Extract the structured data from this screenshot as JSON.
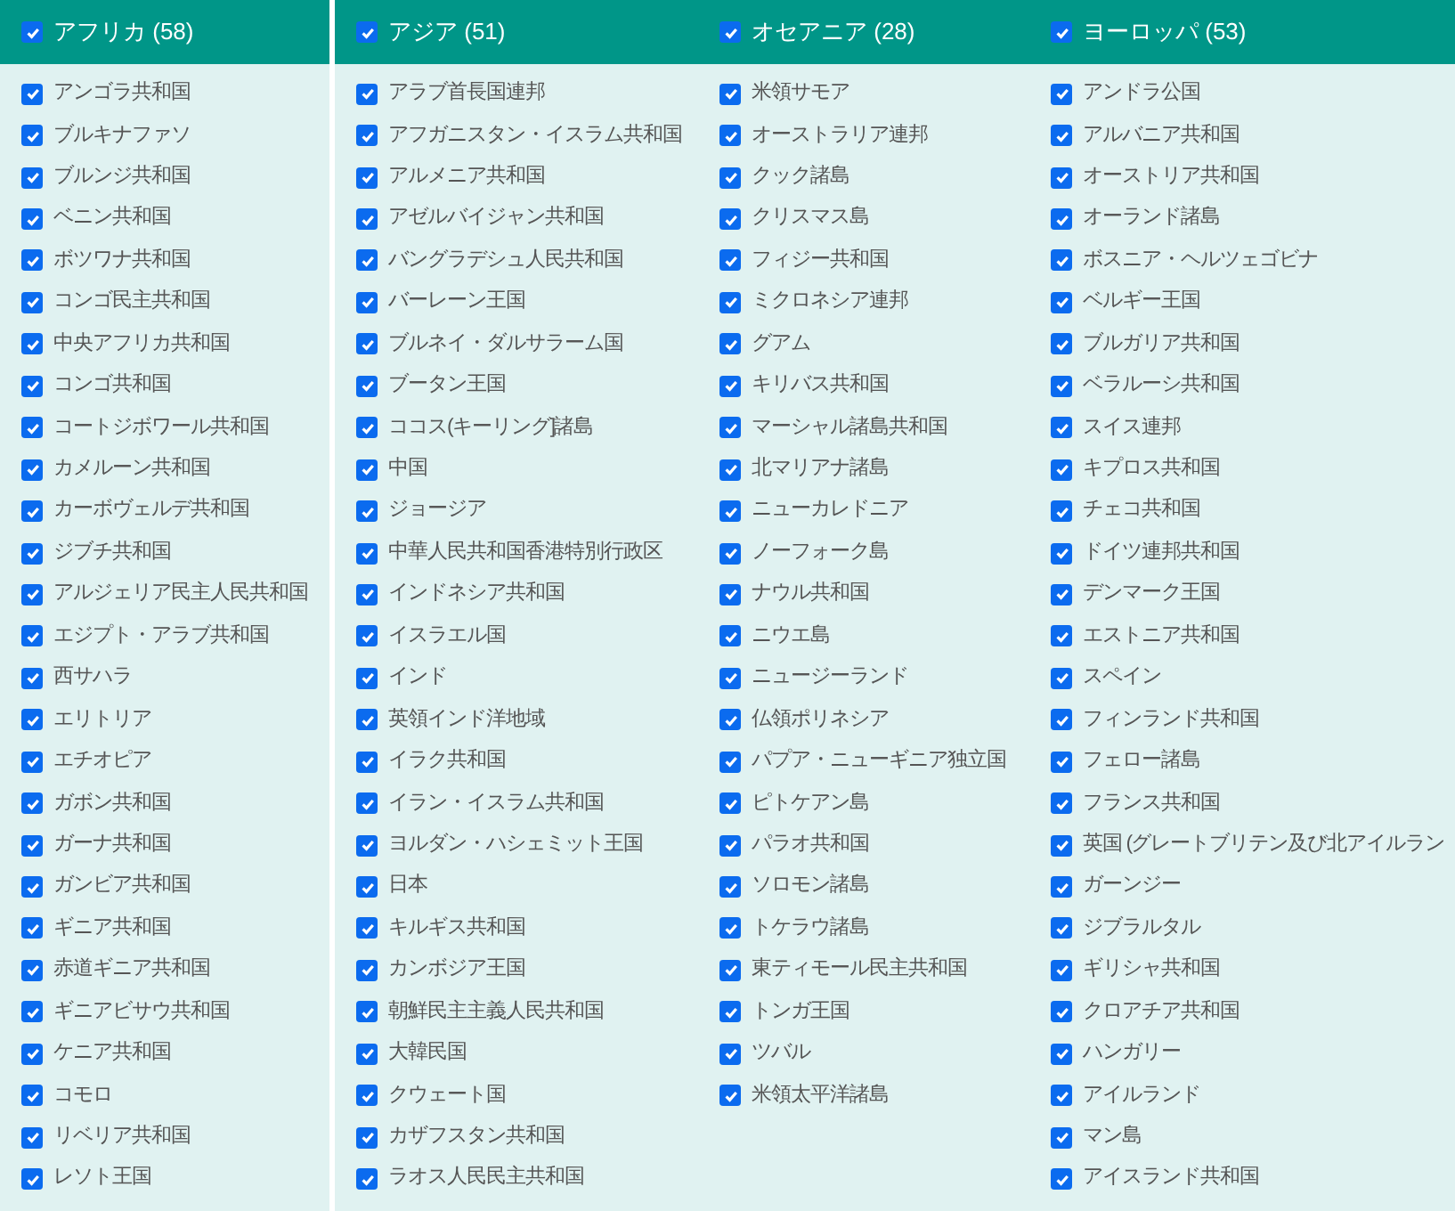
{
  "regions": [
    {
      "title": "アフリカ (58)",
      "checked": true,
      "items": [
        {
          "label": "アンゴラ共和国",
          "checked": true
        },
        {
          "label": "ブルキナファソ",
          "checked": true
        },
        {
          "label": "ブルンジ共和国",
          "checked": true
        },
        {
          "label": "ベニン共和国",
          "checked": true
        },
        {
          "label": "ボツワナ共和国",
          "checked": true
        },
        {
          "label": "コンゴ民主共和国",
          "checked": true
        },
        {
          "label": "中央アフリカ共和国",
          "checked": true
        },
        {
          "label": "コンゴ共和国",
          "checked": true
        },
        {
          "label": "コートジボワール共和国",
          "checked": true
        },
        {
          "label": "カメルーン共和国",
          "checked": true
        },
        {
          "label": "カーボヴェルデ共和国",
          "checked": true
        },
        {
          "label": "ジブチ共和国",
          "checked": true
        },
        {
          "label": "アルジェリア民主人民共和国",
          "checked": true
        },
        {
          "label": "エジプト・アラブ共和国",
          "checked": true
        },
        {
          "label": "西サハラ",
          "checked": true
        },
        {
          "label": "エリトリア",
          "checked": true
        },
        {
          "label": "エチオピア",
          "checked": true
        },
        {
          "label": "ガボン共和国",
          "checked": true
        },
        {
          "label": "ガーナ共和国",
          "checked": true
        },
        {
          "label": "ガンビア共和国",
          "checked": true
        },
        {
          "label": "ギニア共和国",
          "checked": true
        },
        {
          "label": "赤道ギニア共和国",
          "checked": true
        },
        {
          "label": "ギニアビサウ共和国",
          "checked": true
        },
        {
          "label": "ケニア共和国",
          "checked": true
        },
        {
          "label": "コモロ",
          "checked": true
        },
        {
          "label": "リベリア共和国",
          "checked": true
        },
        {
          "label": "レソト王国",
          "checked": true
        }
      ]
    },
    {
      "title": "アジア (51)",
      "checked": true,
      "items": [
        {
          "label": "アラブ首長国連邦",
          "checked": true
        },
        {
          "label": "アフガニスタン・イスラム共和国",
          "checked": true
        },
        {
          "label": "アルメニア共和国",
          "checked": true
        },
        {
          "label": "アゼルバイジャン共和国",
          "checked": true
        },
        {
          "label": "バングラデシュ人民共和国",
          "checked": true
        },
        {
          "label": "バーレーン王国",
          "checked": true
        },
        {
          "label": "ブルネイ・ダルサラーム国",
          "checked": true
        },
        {
          "label": "ブータン王国",
          "checked": true
        },
        {
          "label": "ココス(キーリング]諸島",
          "checked": true
        },
        {
          "label": "中国",
          "checked": true
        },
        {
          "label": "ジョージア",
          "checked": true
        },
        {
          "label": "中華人民共和国香港特別行政区",
          "checked": true
        },
        {
          "label": "インドネシア共和国",
          "checked": true
        },
        {
          "label": "イスラエル国",
          "checked": true
        },
        {
          "label": "インド",
          "checked": true
        },
        {
          "label": "英領インド洋地域",
          "checked": true
        },
        {
          "label": "イラク共和国",
          "checked": true
        },
        {
          "label": "イラン・イスラム共和国",
          "checked": true
        },
        {
          "label": "ヨルダン・ハシェミット王国",
          "checked": true
        },
        {
          "label": "日本",
          "checked": true
        },
        {
          "label": "キルギス共和国",
          "checked": true
        },
        {
          "label": "カンボジア王国",
          "checked": true
        },
        {
          "label": "朝鮮民主主義人民共和国",
          "checked": true
        },
        {
          "label": "大韓民国",
          "checked": true
        },
        {
          "label": "クウェート国",
          "checked": true
        },
        {
          "label": "カザフスタン共和国",
          "checked": true
        },
        {
          "label": "ラオス人民民主共和国",
          "checked": true
        }
      ]
    },
    {
      "title": "オセアニア (28)",
      "checked": true,
      "items": [
        {
          "label": "米領サモア",
          "checked": true
        },
        {
          "label": "オーストラリア連邦",
          "checked": true
        },
        {
          "label": "クック諸島",
          "checked": true
        },
        {
          "label": "クリスマス島",
          "checked": true
        },
        {
          "label": "フィジー共和国",
          "checked": true
        },
        {
          "label": "ミクロネシア連邦",
          "checked": true
        },
        {
          "label": "グアム",
          "checked": true
        },
        {
          "label": "キリバス共和国",
          "checked": true
        },
        {
          "label": "マーシャル諸島共和国",
          "checked": true
        },
        {
          "label": "北マリアナ諸島",
          "checked": true
        },
        {
          "label": "ニューカレドニア",
          "checked": true
        },
        {
          "label": "ノーフォーク島",
          "checked": true
        },
        {
          "label": "ナウル共和国",
          "checked": true
        },
        {
          "label": "ニウエ島",
          "checked": true
        },
        {
          "label": "ニュージーランド",
          "checked": true
        },
        {
          "label": "仏領ポリネシア",
          "checked": true
        },
        {
          "label": "パプア・ニューギニア独立国",
          "checked": true
        },
        {
          "label": "ピトケアン島",
          "checked": true
        },
        {
          "label": "パラオ共和国",
          "checked": true
        },
        {
          "label": "ソロモン諸島",
          "checked": true
        },
        {
          "label": "トケラウ諸島",
          "checked": true
        },
        {
          "label": "東ティモール民主共和国",
          "checked": true
        },
        {
          "label": "トンガ王国",
          "checked": true
        },
        {
          "label": "ツバル",
          "checked": true
        },
        {
          "label": "米領太平洋諸島",
          "checked": true
        }
      ]
    },
    {
      "title": "ヨーロッパ (53)",
      "checked": true,
      "items": [
        {
          "label": "アンドラ公国",
          "checked": true
        },
        {
          "label": "アルバニア共和国",
          "checked": true
        },
        {
          "label": "オーストリア共和国",
          "checked": true
        },
        {
          "label": "オーランド諸島",
          "checked": true
        },
        {
          "label": "ボスニア・ヘルツェゴビナ",
          "checked": true
        },
        {
          "label": "ベルギー王国",
          "checked": true
        },
        {
          "label": "ブルガリア共和国",
          "checked": true
        },
        {
          "label": "ベラルーシ共和国",
          "checked": true
        },
        {
          "label": "スイス連邦",
          "checked": true
        },
        {
          "label": "キプロス共和国",
          "checked": true
        },
        {
          "label": "チェコ共和国",
          "checked": true
        },
        {
          "label": "ドイツ連邦共和国",
          "checked": true
        },
        {
          "label": "デンマーク王国",
          "checked": true
        },
        {
          "label": "エストニア共和国",
          "checked": true
        },
        {
          "label": "スペイン",
          "checked": true
        },
        {
          "label": "フィンランド共和国",
          "checked": true
        },
        {
          "label": "フェロー諸島",
          "checked": true
        },
        {
          "label": "フランス共和国",
          "checked": true
        },
        {
          "label": "英国 (グレートブリテン及び北アイルラン",
          "checked": true
        },
        {
          "label": "ガーンジー",
          "checked": true
        },
        {
          "label": "ジブラルタル",
          "checked": true
        },
        {
          "label": "ギリシャ共和国",
          "checked": true
        },
        {
          "label": "クロアチア共和国",
          "checked": true
        },
        {
          "label": "ハンガリー",
          "checked": true
        },
        {
          "label": "アイルランド",
          "checked": true
        },
        {
          "label": "マン島",
          "checked": true
        },
        {
          "label": "アイスランド共和国",
          "checked": true
        }
      ]
    }
  ]
}
